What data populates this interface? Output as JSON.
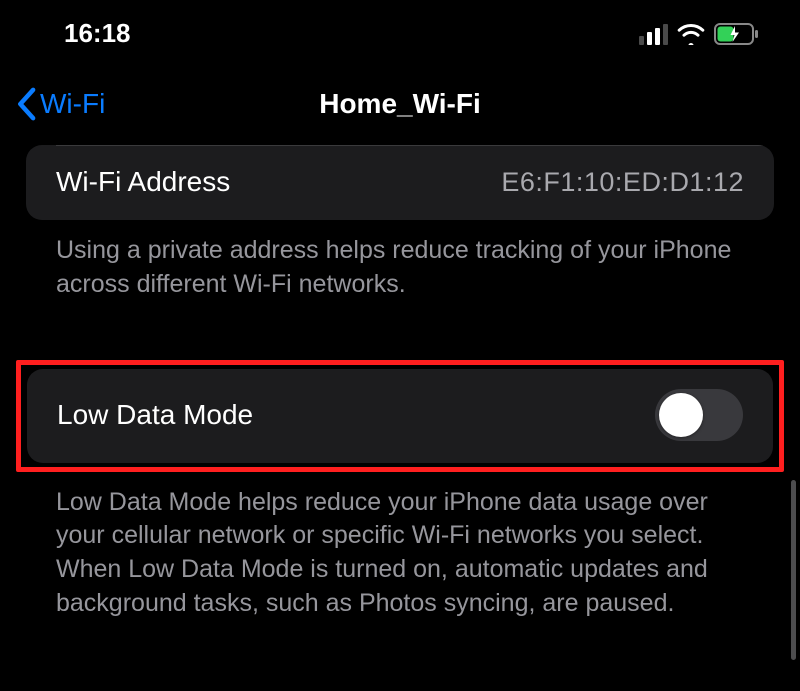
{
  "status": {
    "time": "16:18"
  },
  "nav": {
    "back_label": "Wi-Fi",
    "title": "Home_Wi-Fi"
  },
  "wifi_address": {
    "label": "Wi-Fi Address",
    "value": "E6:F1:10:ED:D1:12",
    "footer": "Using a private address helps reduce tracking of your iPhone across different Wi-Fi networks."
  },
  "low_data_mode": {
    "label": "Low Data Mode",
    "enabled": false,
    "footer": "Low Data Mode helps reduce your iPhone data usage over your cellular network or specific Wi-Fi networks you select. When Low Data Mode is turned on, automatic updates and background tasks, such as Photos syncing, are paused."
  }
}
